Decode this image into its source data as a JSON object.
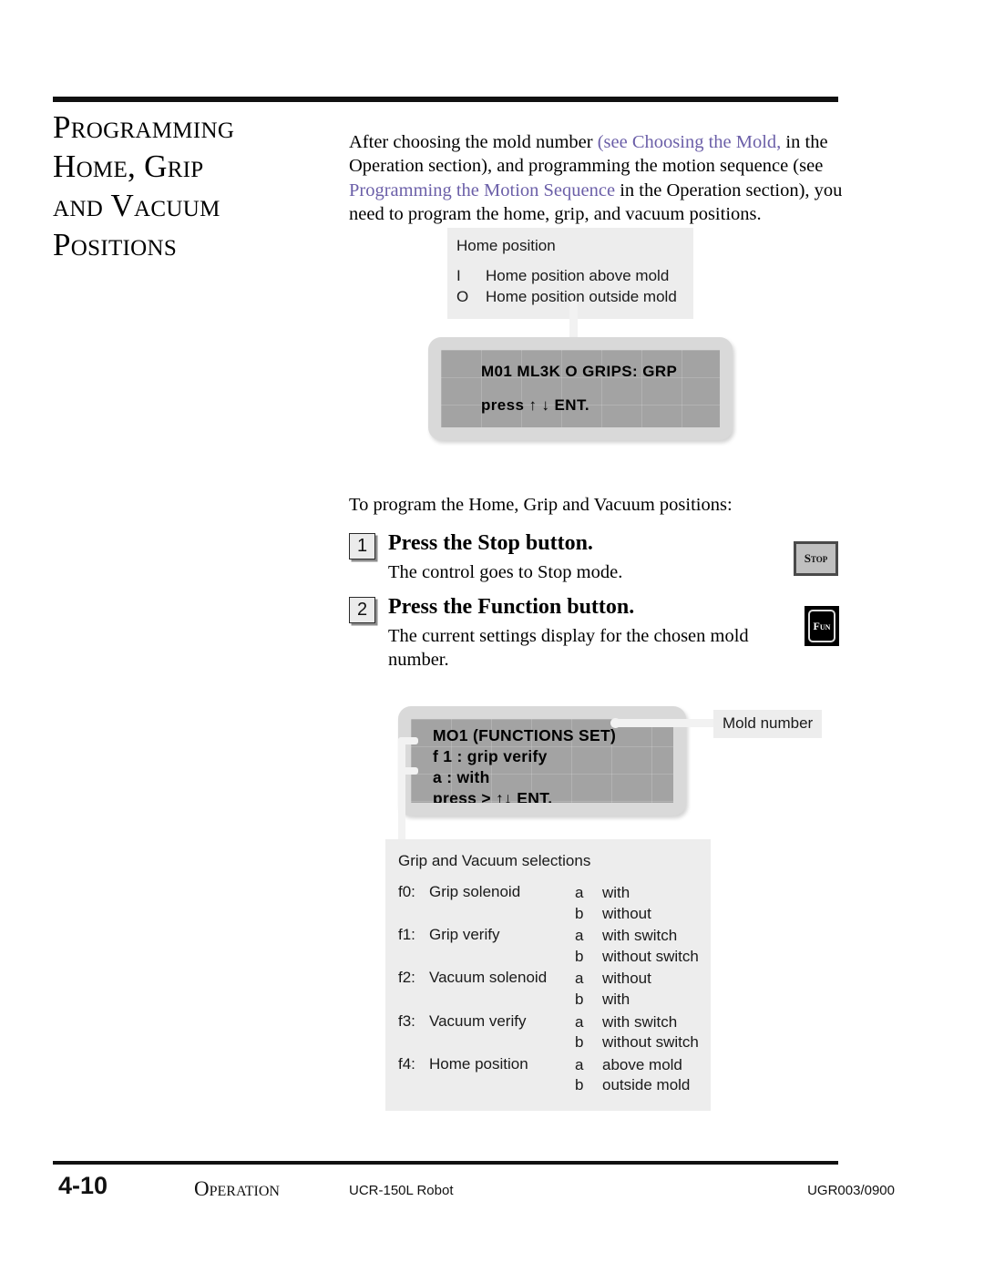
{
  "chapter": {
    "title_lines": [
      "Programming",
      "Home, Grip",
      "and  Vacuum",
      "Positions"
    ]
  },
  "intro": {
    "part1": "After choosing the mold number ",
    "link1": "(see Choosing the Mold,",
    "part2": " in the Operation section), and programming the motion sequence (see ",
    "link2": "Programming the Motion Sequence",
    "part3": " in the Operation section), you need to program the home, grip, and vacuum positions."
  },
  "callout_home": {
    "title": "Home position",
    "rows": [
      {
        "key": "I",
        "text": "Home position above mold"
      },
      {
        "key": "O",
        "text": "Home position outside mold"
      }
    ]
  },
  "lcd1": {
    "line1": "M01  ML3K  O  GRIPS:  GRP",
    "line2": "press ↑ ↓  ENT."
  },
  "to_program": "To program the Home, Grip and Vacuum positions:",
  "steps": [
    {
      "number": "1",
      "title": "Press the Stop button.",
      "body": "The control goes to Stop mode.",
      "button_label": "Stop"
    },
    {
      "number": "2",
      "title": "Press the Function button.",
      "body": "The current settings display for the chosen mold number.",
      "button_label": "Fun"
    }
  ],
  "lcd2": {
    "line1": "MO1  (FUNCTIONS SET)",
    "line2": "f 1  :  grip verify",
    "line3": "a : with",
    "line4": "press >  ↑↓ ENT."
  },
  "label_mold_number": "Mold number",
  "selections": {
    "title": "Grip and Vacuum selections",
    "rows": [
      {
        "code": "f0:",
        "name": "Grip solenoid",
        "options": [
          {
            "key": "a",
            "text": "with"
          },
          {
            "key": "b",
            "text": "without"
          }
        ]
      },
      {
        "code": "f1:",
        "name": "Grip verify",
        "options": [
          {
            "key": "a",
            "text": "with switch"
          },
          {
            "key": "b",
            "text": "without switch"
          }
        ]
      },
      {
        "code": "f2:",
        "name": "Vacuum solenoid",
        "options": [
          {
            "key": "a",
            "text": "without"
          },
          {
            "key": "b",
            "text": "with"
          }
        ]
      },
      {
        "code": "f3:",
        "name": "Vacuum verify",
        "options": [
          {
            "key": "a",
            "text": "with switch"
          },
          {
            "key": "b",
            "text": "without switch"
          }
        ]
      },
      {
        "code": "f4:",
        "name": "Home position",
        "options": [
          {
            "key": "a",
            "text": "above mold"
          },
          {
            "key": "b",
            "text": "outside mold"
          }
        ]
      }
    ]
  },
  "footer": {
    "page_number": "4-10",
    "section": "Operation",
    "model": "UCR-150L Robot",
    "doc_code": "UGR003/0900"
  },
  "colors": {
    "link": "#6b5fa8",
    "panel_gray": "#ededed",
    "lcd_screen": "#a3a3a3",
    "lcd_bezel": "#d9d9d9",
    "rule": "#111111"
  }
}
